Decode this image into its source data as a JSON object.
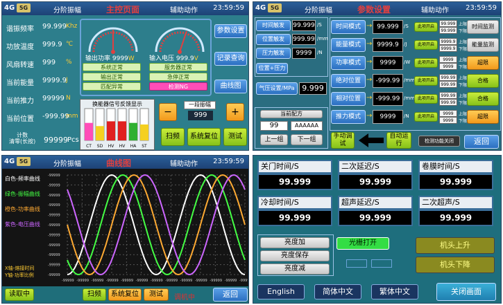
{
  "colors": {
    "topbar": "#1d4275",
    "panel_bg": "#2d7e8c",
    "accent_red": "#e04040",
    "green": "#86c21a",
    "orange": "#f29a1c",
    "pink": "#ff4db8"
  },
  "common": {
    "sig": "4G",
    "sig2": "5G",
    "menu1": "分阶振幅",
    "menu2": "辅助动作",
    "clock": "23:59:59"
  },
  "p1": {
    "title": "主控页面",
    "rows": [
      {
        "label": "谐振频率",
        "value": "99.999",
        "unit": "Khz"
      },
      {
        "label": "功放温度",
        "value": "999.9",
        "unit": "℃"
      },
      {
        "label": "风扇转速",
        "value": "999",
        "unit": "%"
      },
      {
        "label": "当前能量",
        "value": "9999.9",
        "unit": "J"
      },
      {
        "label": "当前推力",
        "value": "99999",
        "unit": "N"
      },
      {
        "label": "当前位置",
        "value": "-999.99",
        "unit": "mm"
      }
    ],
    "count_label1": "计数",
    "count_label2": "清零(长按)",
    "count_value": "99999",
    "count_unit": "Pcs",
    "gauge1_label": "输出功率 9999",
    "gauge1_unit": "W",
    "gauge2_label": "输入电压 999.9",
    "gauge2_unit": "V",
    "status": [
      {
        "text": "系统正常",
        "type": "green"
      },
      {
        "text": "服务器正常",
        "type": "green"
      },
      {
        "text": "输出正常",
        "type": "green"
      },
      {
        "text": "急停正常",
        "type": "green"
      },
      {
        "text": "匹配异常",
        "type": "green"
      },
      {
        "text": "检测NG",
        "type": "pink"
      }
    ],
    "side_buttons": [
      "参数设置",
      "记录查询",
      "曲线图"
    ],
    "signal_title": "换能器信号反馈显示",
    "signal_bars": [
      {
        "label": "CT",
        "level": 0.55,
        "color": "#ff4db8"
      },
      {
        "label": "SD",
        "level": 0.45,
        "color": "#f5d020"
      },
      {
        "label": "HV",
        "level": 0.6,
        "color": "#e02020"
      },
      {
        "label": "HV",
        "level": 0.6,
        "color": "#e02020"
      },
      {
        "label": "HA",
        "level": 0.55,
        "color": "#30b030"
      },
      {
        "label": "ST",
        "level": 0.5,
        "color": "#f5d020"
      }
    ],
    "amp_label": "一段振幅",
    "amp_value": "999",
    "minus": "−",
    "plus": "+",
    "bottom_buttons": [
      "扫频",
      "系统复位",
      "测试"
    ]
  },
  "p2": {
    "title": "参数设置",
    "left_rows": [
      {
        "label": "时间触发",
        "value": "99.999",
        "unit": "/S"
      },
      {
        "label": "位置触发",
        "value": "999.99",
        "unit": "/mm"
      },
      {
        "label": "压力触发",
        "value": "9999",
        "unit": "/N"
      }
    ],
    "pos_pressure": "位置+压力",
    "air_label": "气压设置/MPa",
    "air_value": "9.999",
    "recipe_label": "当前配方",
    "recipe_num": "99",
    "recipe_name": "AAAAAA",
    "prev": "上一组",
    "next": "下一组",
    "modes": [
      {
        "label": "时间模式",
        "value": "99.999",
        "unit": "/S",
        "hint": "此项开启",
        "v1": "99.999",
        "v2": "99.999",
        "u1": "上限",
        "u2": "下限",
        "side": "时间监测",
        "side_type": "gray"
      },
      {
        "label": "能量模式",
        "value": "9999.9",
        "unit": "/J",
        "hint": "此项开启",
        "v1": "9999.9",
        "v2": "9999.9",
        "u1": "上限",
        "u2": "下限",
        "side": "能量监测",
        "side_type": "gray"
      },
      {
        "label": "功率模式",
        "value": "9999",
        "unit": "/W",
        "hint": "此项开启",
        "v1": "9999",
        "v2": "9999",
        "u1": "上限",
        "u2": "下限",
        "side": "超限",
        "side_type": "orange"
      },
      {
        "label": "绝对位置",
        "value": "-999.99",
        "unit": "/mm",
        "hint": "此项开启",
        "v1": "999.99",
        "v2": "999.99",
        "u1": "上限",
        "u2": "下限",
        "side": "合格",
        "side_type": "green"
      },
      {
        "label": "相对位置",
        "value": "-999.99",
        "unit": "/mm",
        "hint": "此项开启",
        "v1": "999.99",
        "v2": "999.99",
        "u1": "上限",
        "u2": "下限",
        "side": "合格",
        "side_type": "green"
      },
      {
        "label": "推力模式",
        "value": "9999",
        "unit": "/N",
        "hint": "此项开启",
        "v1": "9999",
        "v2": "9999",
        "u1": "上限",
        "u2": "下限",
        "side": "超限",
        "side_type": "orange"
      }
    ],
    "manual": "手动调试",
    "auto": "自动运行",
    "detect_off": "检测功能关闭",
    "back": "返回"
  },
  "p3": {
    "title": "曲线图",
    "legend": [
      {
        "text": "白色-频率曲线",
        "color": "#ffffff"
      },
      {
        "text": "绿色-振幅曲线",
        "color": "#44ff44"
      },
      {
        "text": "橙色-功率曲线",
        "color": "#ffaa33"
      },
      {
        "text": "紫色-电压曲线",
        "color": "#cc66ff"
      }
    ],
    "x_label": "X轴-熔接时间",
    "y_label": "Y轴-功率比例",
    "tick": "-99999",
    "read": "读取中",
    "buttons": [
      "扫频",
      "系统复位",
      "测试"
    ],
    "alarm": "调机中",
    "back": "返回",
    "chart_data": {
      "type": "line",
      "series": [
        {
          "name": "白色-频率曲线",
          "color": "#ffffff",
          "phase": 0.0
        },
        {
          "name": "绿色-振幅曲线",
          "color": "#44ff44",
          "phase": 0.25
        },
        {
          "name": "橙色-功率曲线",
          "color": "#ffaa33",
          "phase": 0.5
        },
        {
          "name": "紫色-电压曲线",
          "color": "#cc66ff",
          "phase": 0.75
        }
      ],
      "grid": true
    }
  },
  "p4": {
    "boxes": [
      {
        "label": "关门时间/S",
        "value": "99.999"
      },
      {
        "label": "二次延迟/S",
        "value": "99.999"
      },
      {
        "label": "卷膜时间/S",
        "value": "99.999"
      },
      {
        "label": "冷却时间/S",
        "value": "99.999"
      },
      {
        "label": "超声延迟/S",
        "value": "99.999"
      },
      {
        "label": "二次超声/S",
        "value": "99.999"
      }
    ],
    "bright_up": "亮度加",
    "bright_save": "亮度保存",
    "bright_down": "亮度减",
    "grating": "光栅打开",
    "head_up": "机头上升",
    "head_down": "机头下降",
    "lang_en": "English",
    "lang_sc": "简体中文",
    "lang_tc": "繁体中文",
    "close": "关闭画面"
  }
}
